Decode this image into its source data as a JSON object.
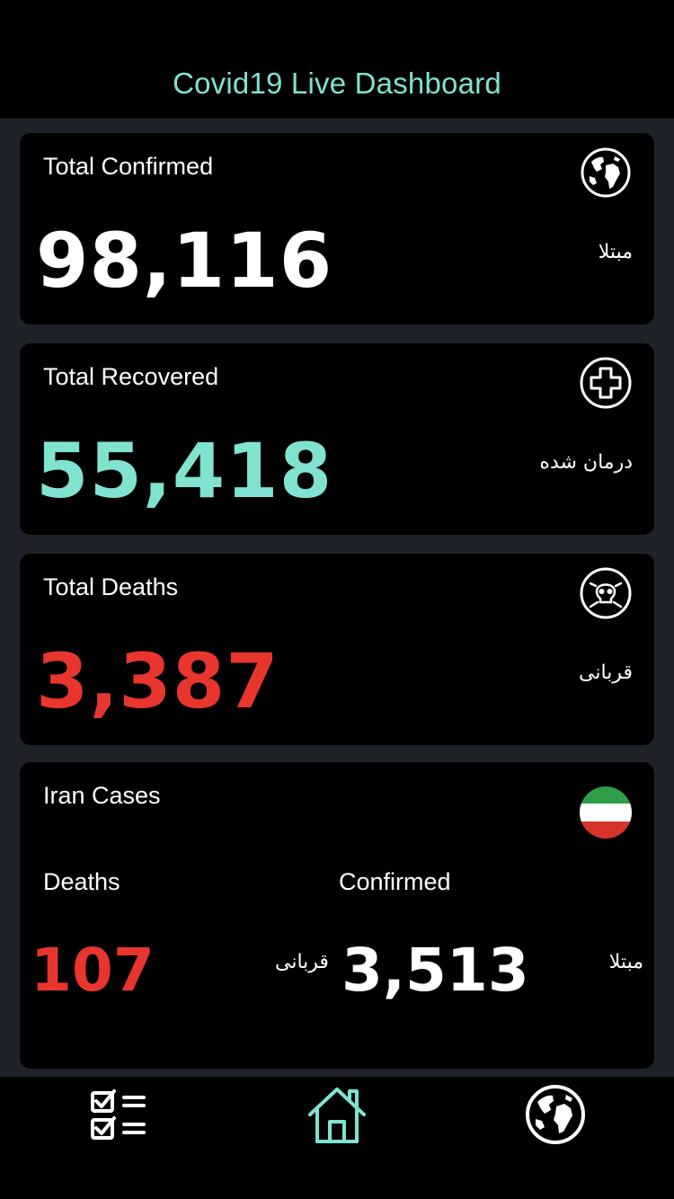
{
  "header": {
    "title": "Covid19 Live Dashboard",
    "title_color": "#7fe3cf"
  },
  "cards": {
    "confirmed": {
      "title": "Total Confirmed",
      "value": "98,116",
      "label_fa": "مبتلا",
      "icon": "globe-icon",
      "color": "#ffffff"
    },
    "recovered": {
      "title": "Total Recovered",
      "value": "55,418",
      "label_fa": "درمان شده",
      "icon": "plus-circle-icon",
      "color": "#7fe3cf"
    },
    "deaths": {
      "title": "Total Deaths",
      "value": "3,387",
      "label_fa": "قربانی",
      "icon": "skull-icon",
      "color": "#e8362e"
    }
  },
  "iran": {
    "title": "Iran Cases",
    "icon": "iran-flag-icon",
    "deaths": {
      "label": "Deaths",
      "value": "107",
      "label_fa": "قربانی"
    },
    "confirmed": {
      "label": "Confirmed",
      "value": "3,513",
      "label_fa": "مبتلا"
    }
  },
  "bottom_nav": {
    "items": [
      {
        "name": "checklist",
        "icon": "checklist-icon"
      },
      {
        "name": "home",
        "icon": "home-icon",
        "active": true
      },
      {
        "name": "world",
        "icon": "globe-icon"
      }
    ]
  }
}
